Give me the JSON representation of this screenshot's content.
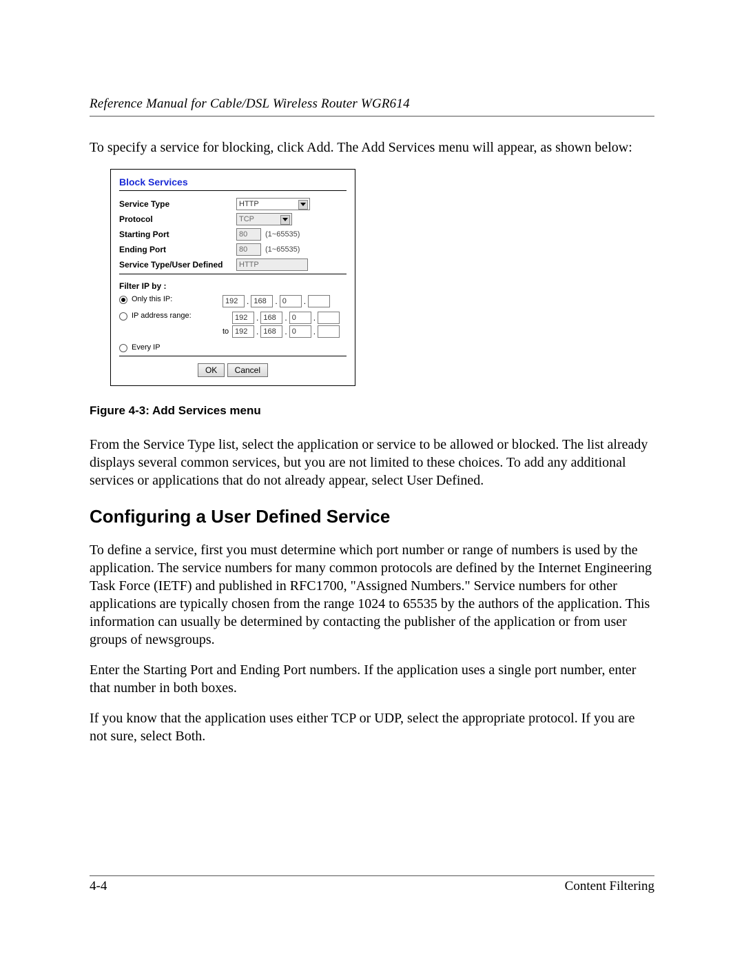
{
  "header": {
    "running_title": "Reference Manual for Cable/DSL Wireless Router WGR614"
  },
  "intro_para": "To specify a service for blocking, click Add. The Add Services menu will appear, as shown below:",
  "dialog": {
    "title": "Block Services",
    "labels": {
      "service_type": "Service Type",
      "protocol": "Protocol",
      "start_port": "Starting Port",
      "end_port": "Ending Port",
      "user_defined": "Service Type/User Defined",
      "filter_by": "Filter IP by :",
      "only_ip": "Only this IP:",
      "ip_range": "IP address range:",
      "to": "to",
      "every_ip": "Every IP"
    },
    "values": {
      "service_type": "HTTP",
      "protocol": "TCP",
      "start_port": "80",
      "end_port": "80",
      "port_range_hint": "(1~65535)",
      "user_defined": "HTTP",
      "only_ip": [
        "192",
        "168",
        "0",
        ""
      ],
      "range_from": [
        "192",
        "168",
        "0",
        ""
      ],
      "range_to": [
        "192",
        "168",
        "0",
        ""
      ]
    },
    "selected_filter": "only_ip",
    "buttons": {
      "ok": "OK",
      "cancel": "Cancel"
    }
  },
  "caption": "Figure 4-3:  Add Services menu",
  "para_after_fig": "From the Service Type list, select the application or service to be allowed or blocked. The list already displays several common services, but you are not limited to these choices. To add any additional services or applications that do not already appear, select User Defined.",
  "section_heading": "Configuring a User Defined Service",
  "para_s1": "To define a service, first you must determine which port number or range of numbers is used by the application. The service numbers for many common protocols are defined by the Internet Engineering Task Force (IETF) and published in RFC1700, \"Assigned Numbers.\" Service numbers for other applications are typically chosen from the range 1024 to 65535 by the authors of the application. This information can usually be determined by contacting the publisher of the application or from user groups of newsgroups.",
  "para_s2": "Enter the Starting Port and Ending Port numbers. If the application uses a single port number, enter that number in both boxes.",
  "para_s3": "If you know that the application uses either TCP or UDP, select the appropriate protocol. If you are not sure, select Both.",
  "footer": {
    "page_num": "4-4",
    "section": "Content Filtering"
  }
}
